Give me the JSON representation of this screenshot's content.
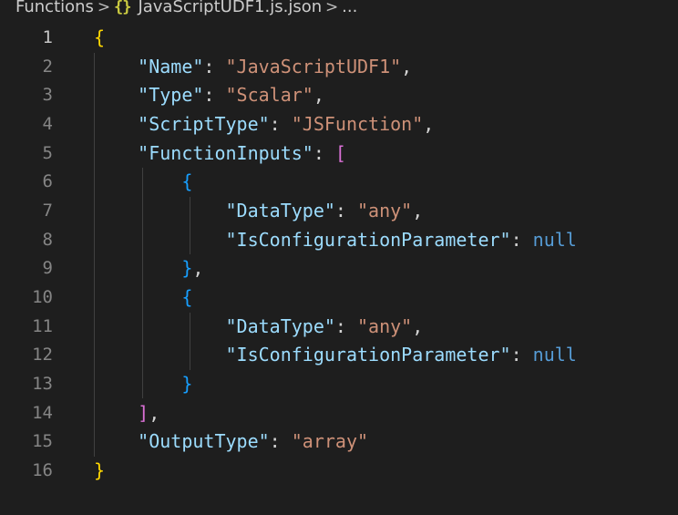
{
  "breadcrumb": {
    "folder": "Functions",
    "separator": ">",
    "file_icon": "{}",
    "file": "JavaScriptUDF1.js.json",
    "ellipsis": "..."
  },
  "editor": {
    "active_line": 1,
    "lines": [
      {
        "n": "1",
        "tokens": [
          {
            "t": "{",
            "c": "br1"
          }
        ]
      },
      {
        "n": "2",
        "tokens": [
          {
            "t": "    "
          },
          {
            "t": "\"Name\"",
            "c": "key"
          },
          {
            "t": ": ",
            "c": "punc"
          },
          {
            "t": "\"JavaScriptUDF1\"",
            "c": "str"
          },
          {
            "t": ",",
            "c": "punc"
          }
        ]
      },
      {
        "n": "3",
        "tokens": [
          {
            "t": "    "
          },
          {
            "t": "\"Type\"",
            "c": "key"
          },
          {
            "t": ": ",
            "c": "punc"
          },
          {
            "t": "\"Scalar\"",
            "c": "str"
          },
          {
            "t": ",",
            "c": "punc"
          }
        ]
      },
      {
        "n": "4",
        "tokens": [
          {
            "t": "    "
          },
          {
            "t": "\"ScriptType\"",
            "c": "key"
          },
          {
            "t": ": ",
            "c": "punc"
          },
          {
            "t": "\"JSFunction\"",
            "c": "str"
          },
          {
            "t": ",",
            "c": "punc"
          }
        ]
      },
      {
        "n": "5",
        "tokens": [
          {
            "t": "    "
          },
          {
            "t": "\"FunctionInputs\"",
            "c": "key"
          },
          {
            "t": ": ",
            "c": "punc"
          },
          {
            "t": "[",
            "c": "br2"
          }
        ]
      },
      {
        "n": "6",
        "tokens": [
          {
            "t": "        "
          },
          {
            "t": "{",
            "c": "br3"
          }
        ]
      },
      {
        "n": "7",
        "tokens": [
          {
            "t": "            "
          },
          {
            "t": "\"DataType\"",
            "c": "key"
          },
          {
            "t": ": ",
            "c": "punc"
          },
          {
            "t": "\"any\"",
            "c": "str"
          },
          {
            "t": ",",
            "c": "punc"
          }
        ]
      },
      {
        "n": "8",
        "tokens": [
          {
            "t": "            "
          },
          {
            "t": "\"IsConfigurationParameter\"",
            "c": "key"
          },
          {
            "t": ": ",
            "c": "punc"
          },
          {
            "t": "null",
            "c": "kw"
          }
        ]
      },
      {
        "n": "9",
        "tokens": [
          {
            "t": "        "
          },
          {
            "t": "}",
            "c": "br3"
          },
          {
            "t": ",",
            "c": "punc"
          }
        ]
      },
      {
        "n": "10",
        "tokens": [
          {
            "t": "        "
          },
          {
            "t": "{",
            "c": "br3"
          }
        ]
      },
      {
        "n": "11",
        "tokens": [
          {
            "t": "            "
          },
          {
            "t": "\"DataType\"",
            "c": "key"
          },
          {
            "t": ": ",
            "c": "punc"
          },
          {
            "t": "\"any\"",
            "c": "str"
          },
          {
            "t": ",",
            "c": "punc"
          }
        ]
      },
      {
        "n": "12",
        "tokens": [
          {
            "t": "            "
          },
          {
            "t": "\"IsConfigurationParameter\"",
            "c": "key"
          },
          {
            "t": ": ",
            "c": "punc"
          },
          {
            "t": "null",
            "c": "kw"
          }
        ]
      },
      {
        "n": "13",
        "tokens": [
          {
            "t": "        "
          },
          {
            "t": "}",
            "c": "br3"
          }
        ]
      },
      {
        "n": "14",
        "tokens": [
          {
            "t": "    "
          },
          {
            "t": "]",
            "c": "br2"
          },
          {
            "t": ",",
            "c": "punc"
          }
        ]
      },
      {
        "n": "15",
        "tokens": [
          {
            "t": "    "
          },
          {
            "t": "\"OutputType\"",
            "c": "key"
          },
          {
            "t": ": ",
            "c": "punc"
          },
          {
            "t": "\"array\"",
            "c": "str"
          }
        ]
      },
      {
        "n": "16",
        "tokens": [
          {
            "t": "}",
            "c": "br1"
          }
        ]
      }
    ]
  },
  "colors": {
    "background": "#1e1e1e",
    "key": "#9cdcfe",
    "string": "#ce9178",
    "keyword": "#569cd6",
    "bracket_level1": "#ffd700",
    "bracket_level2": "#da70d6",
    "bracket_level3": "#179fff"
  }
}
